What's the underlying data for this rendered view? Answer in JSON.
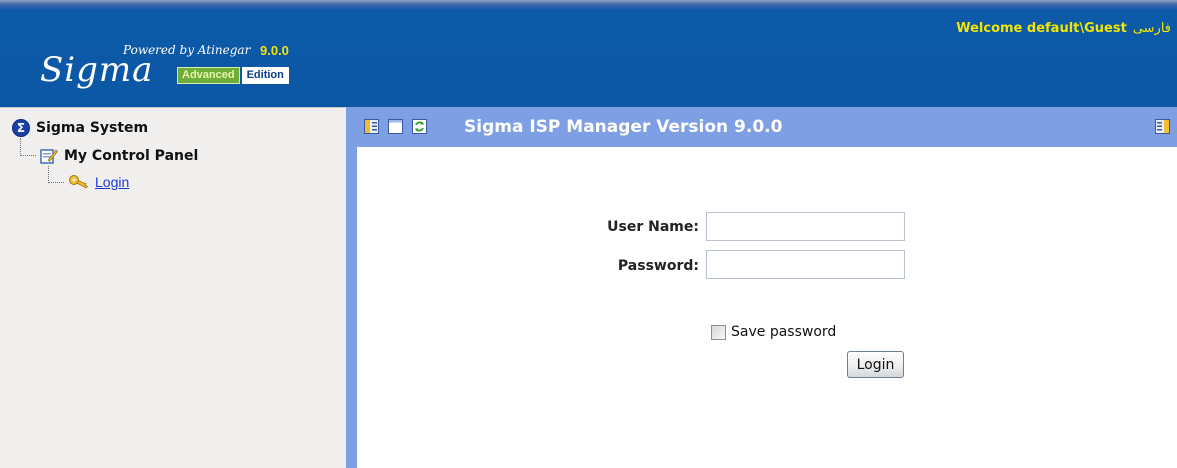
{
  "header": {
    "logo": {
      "powered_by": "Powered by Atinegar",
      "version": "9.0.0",
      "name": "Sigma",
      "badge_advanced": "Advanced",
      "badge_edition": "Edition"
    },
    "welcome_text": "Welcome default\\Guest",
    "language_link": "فارسی",
    "colors": {
      "header_bg": "#0b57a6",
      "accent_yellow": "#f2e600"
    }
  },
  "sidebar": {
    "tree": {
      "root_label": "Sigma System",
      "root_icon": "sigma-icon",
      "panel_label": "My Control Panel",
      "panel_icon": "control-panel-icon",
      "login_label": "Login",
      "login_icon": "key-icon"
    }
  },
  "titlebar": {
    "title": "Sigma ISP Manager Version 9.0.0",
    "icons": [
      "toggle-sidebar-icon",
      "window-icon",
      "refresh-icon"
    ],
    "right_icon": "toggle-right-panel-icon",
    "color": "#7f9fe4"
  },
  "login_form": {
    "username_label": "User Name:",
    "username_value": "",
    "password_label": "Password:",
    "password_value": "",
    "save_password_label": "Save password",
    "save_password_checked": false,
    "login_button": "Login"
  }
}
